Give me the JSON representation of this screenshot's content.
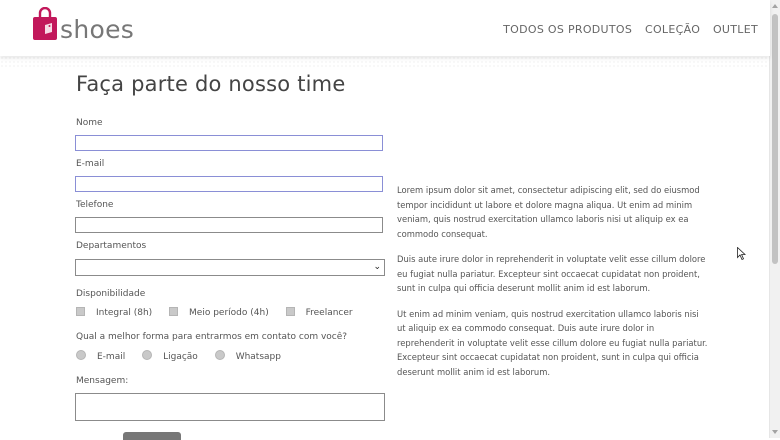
{
  "header": {
    "brand": "shoes",
    "nav": [
      "TODOS OS PRODUTOS",
      "COLEÇÃO",
      "OUTLET"
    ],
    "accent_color": "#c2185b"
  },
  "page": {
    "title": "Faça parte do nosso time"
  },
  "form": {
    "name_label": "Nome",
    "email_label": "E-mail",
    "phone_label": "Telefone",
    "department_label": "Departamentos",
    "department_value": "",
    "availability_label": "Disponibilidade",
    "availability_options": [
      "Integral (8h)",
      "Meio período (4h)",
      "Freelancer"
    ],
    "contact_label": "Qual a melhor forma para entrarmos em contato com você?",
    "contact_options": [
      "E-mail",
      "Ligação",
      "Whatsapp"
    ],
    "message_label": "Mensagem:"
  },
  "side": {
    "paragraphs": [
      "Lorem ipsum dolor sit amet, consectetur adipiscing elit, sed do eiusmod tempor incididunt ut labore et dolore magna aliqua. Ut enim ad minim veniam, quis nostrud exercitation ullamco laboris nisi ut aliquip ex ea commodo consequat.",
      "Duis aute irure dolor in reprehenderit in voluptate velit esse cillum dolore eu fugiat nulla pariatur. Excepteur sint occaecat cupidatat non proident, sunt in culpa qui officia deserunt mollit anim id est laborum.",
      "Ut enim ad minim veniam, quis nostrud exercitation ullamco laboris nisi ut aliquip ex ea commodo consequat. Duis aute irure dolor in reprehenderit in voluptate velit esse cillum dolore eu fugiat nulla pariatur. Excepteur sint occaecat cupidatat non proident, sunt in culpa qui officia deserunt mollit anim id est laborum."
    ]
  },
  "icons": {
    "logo": "shopping-bag-icon",
    "select_chevron": "chevron-down-icon",
    "cursor": "mouse-pointer-icon"
  }
}
